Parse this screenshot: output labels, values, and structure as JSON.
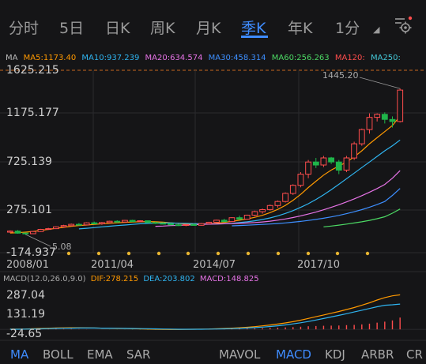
{
  "tabs": [
    {
      "label": "分时"
    },
    {
      "label": "5日"
    },
    {
      "label": "日K"
    },
    {
      "label": "周K"
    },
    {
      "label": "月K"
    },
    {
      "label": "季K",
      "active": true
    },
    {
      "label": "年K"
    },
    {
      "label": "1分"
    }
  ],
  "accent": "#3f8cff",
  "ma_legend": {
    "ma": "MA",
    "ma5": "MA5:1173.40",
    "ma10": "MA10:937.239",
    "ma20": "MA20:634.574",
    "ma30": "MA30:458.314",
    "ma60": "MA60:256.263",
    "ma120": "MA120:",
    "ma250": "MA250:"
  },
  "ma_colors": {
    "ma5": "#ff9900",
    "ma10": "#2fb4f0",
    "ma20": "#e673e6",
    "ma30": "#3d8fff",
    "ma60": "#4cd964",
    "ma120": "#ff4d4d",
    "ma250": "#44c8d8"
  },
  "price_axis": [
    "1625.215",
    "1175.177",
    "725.139",
    "275.101",
    "-174.937"
  ],
  "annotations": {
    "high": "1445.20",
    "low": "5.08"
  },
  "time_axis": [
    "2008/01",
    "2011/04",
    "2014/07",
    "2017/10"
  ],
  "macd_legend": {
    "params": "MACD(12.0,26.0,9.0)",
    "dif": "DIF:278.215",
    "dea": "DEA:203.802",
    "macd": "MACD:148.825"
  },
  "macd_axis": [
    "287.04",
    "131.19",
    "-24.65"
  ],
  "indicator_tabs_left": [
    "MA",
    "BOLL",
    "EMA",
    "SAR"
  ],
  "indicator_tabs_right": [
    "MAVOL",
    "MACD",
    "KDJ",
    "ARBR",
    "CR"
  ],
  "chart_data": {
    "type": "candlestick",
    "period": "quarterly",
    "price_range": [
      -174.937,
      1625.215
    ],
    "first_label": "2008/01",
    "candles": [
      {
        "o": 28,
        "h": 45,
        "l": 22,
        "c": 38
      },
      {
        "o": 38,
        "h": 48,
        "l": 12,
        "c": 18
      },
      {
        "o": 18,
        "h": 25,
        "l": 5.08,
        "c": 12
      },
      {
        "o": 12,
        "h": 40,
        "l": 10,
        "c": 34
      },
      {
        "o": 34,
        "h": 60,
        "l": 30,
        "c": 55
      },
      {
        "o": 55,
        "h": 70,
        "l": 50,
        "c": 62
      },
      {
        "o": 62,
        "h": 85,
        "l": 58,
        "c": 80
      },
      {
        "o": 80,
        "h": 100,
        "l": 70,
        "c": 92
      },
      {
        "o": 92,
        "h": 112,
        "l": 85,
        "c": 105
      },
      {
        "o": 105,
        "h": 118,
        "l": 95,
        "c": 100
      },
      {
        "o": 100,
        "h": 125,
        "l": 95,
        "c": 120
      },
      {
        "o": 120,
        "h": 132,
        "l": 105,
        "c": 110
      },
      {
        "o": 110,
        "h": 128,
        "l": 100,
        "c": 122
      },
      {
        "o": 122,
        "h": 140,
        "l": 115,
        "c": 135
      },
      {
        "o": 135,
        "h": 145,
        "l": 120,
        "c": 128
      },
      {
        "o": 128,
        "h": 148,
        "l": 122,
        "c": 144
      },
      {
        "o": 144,
        "h": 150,
        "l": 130,
        "c": 132
      },
      {
        "o": 132,
        "h": 145,
        "l": 125,
        "c": 140
      },
      {
        "o": 140,
        "h": 142,
        "l": 118,
        "c": 122
      },
      {
        "o": 122,
        "h": 130,
        "l": 108,
        "c": 115
      },
      {
        "o": 115,
        "h": 125,
        "l": 105,
        "c": 110
      },
      {
        "o": 110,
        "h": 118,
        "l": 95,
        "c": 100
      },
      {
        "o": 100,
        "h": 110,
        "l": 88,
        "c": 95
      },
      {
        "o": 95,
        "h": 108,
        "l": 86,
        "c": 102
      },
      {
        "o": 102,
        "h": 112,
        "l": 92,
        "c": 96
      },
      {
        "o": 96,
        "h": 118,
        "l": 92,
        "c": 112
      },
      {
        "o": 112,
        "h": 130,
        "l": 105,
        "c": 125
      },
      {
        "o": 125,
        "h": 150,
        "l": 118,
        "c": 145
      },
      {
        "o": 145,
        "h": 160,
        "l": 125,
        "c": 132
      },
      {
        "o": 132,
        "h": 175,
        "l": 128,
        "c": 170
      },
      {
        "o": 170,
        "h": 190,
        "l": 150,
        "c": 155
      },
      {
        "o": 155,
        "h": 200,
        "l": 150,
        "c": 195
      },
      {
        "o": 195,
        "h": 240,
        "l": 185,
        "c": 230
      },
      {
        "o": 230,
        "h": 260,
        "l": 210,
        "c": 250
      },
      {
        "o": 250,
        "h": 300,
        "l": 240,
        "c": 290
      },
      {
        "o": 290,
        "h": 340,
        "l": 270,
        "c": 330
      },
      {
        "o": 330,
        "h": 420,
        "l": 320,
        "c": 410
      },
      {
        "o": 410,
        "h": 500,
        "l": 395,
        "c": 490
      },
      {
        "o": 490,
        "h": 620,
        "l": 470,
        "c": 600
      },
      {
        "o": 600,
        "h": 740,
        "l": 560,
        "c": 720
      },
      {
        "o": 720,
        "h": 760,
        "l": 660,
        "c": 690
      },
      {
        "o": 690,
        "h": 780,
        "l": 670,
        "c": 760
      },
      {
        "o": 760,
        "h": 770,
        "l": 700,
        "c": 720
      },
      {
        "o": 720,
        "h": 740,
        "l": 600,
        "c": 640
      },
      {
        "o": 640,
        "h": 780,
        "l": 620,
        "c": 760
      },
      {
        "o": 760,
        "h": 920,
        "l": 740,
        "c": 900
      },
      {
        "o": 900,
        "h": 1050,
        "l": 880,
        "c": 1040
      },
      {
        "o": 1040,
        "h": 1200,
        "l": 1000,
        "c": 1160
      },
      {
        "o": 1160,
        "h": 1200,
        "l": 1120,
        "c": 1190
      },
      {
        "o": 1190,
        "h": 1210,
        "l": 1100,
        "c": 1140
      },
      {
        "o": 1140,
        "h": 1170,
        "l": 1060,
        "c": 1120
      },
      {
        "o": 1120,
        "h": 1445.2,
        "l": 1110,
        "c": 1430
      }
    ],
    "ma_series": {
      "ma5": [
        18,
        22,
        28,
        35,
        45,
        55,
        65,
        75,
        85,
        92,
        98,
        104,
        110,
        115,
        120,
        124,
        128,
        130,
        132,
        130,
        126,
        120,
        114,
        108,
        105,
        104,
        108,
        115,
        124,
        134,
        145,
        158,
        174,
        194,
        220,
        252,
        292,
        342,
        400,
        468,
        530,
        590,
        640,
        680,
        720,
        770,
        830,
        900,
        960,
        1020,
        1080,
        1173.4
      ],
      "ma10": [
        null,
        null,
        null,
        null,
        null,
        null,
        null,
        null,
        null,
        60,
        66,
        72,
        80,
        86,
        92,
        98,
        104,
        110,
        114,
        116,
        118,
        118,
        116,
        114,
        112,
        110,
        108,
        108,
        110,
        115,
        122,
        130,
        140,
        152,
        168,
        188,
        212,
        240,
        272,
        308,
        350,
        396,
        446,
        500,
        555,
        610,
        665,
        720,
        775,
        830,
        880,
        937.239
      ],
      "ma20": [
        null,
        null,
        null,
        null,
        null,
        null,
        null,
        null,
        null,
        null,
        null,
        null,
        null,
        null,
        null,
        null,
        null,
        null,
        null,
        85,
        88,
        92,
        95,
        98,
        101,
        104,
        106,
        108,
        110,
        112,
        114,
        118,
        122,
        128,
        136,
        146,
        158,
        172,
        188,
        206,
        226,
        248,
        272,
        298,
        326,
        356,
        388,
        422,
        458,
        498,
        560,
        634.574
      ],
      "ma30": [
        null,
        null,
        null,
        null,
        null,
        null,
        null,
        null,
        null,
        null,
        null,
        null,
        null,
        null,
        null,
        null,
        null,
        null,
        null,
        null,
        null,
        null,
        null,
        null,
        null,
        null,
        null,
        null,
        null,
        90,
        93,
        96,
        100,
        104,
        108,
        113,
        119,
        126,
        134,
        143,
        153,
        165,
        178,
        193,
        210,
        229,
        250,
        274,
        300,
        330,
        390,
        458.314
      ],
      "ma60": [
        null,
        null,
        null,
        null,
        null,
        null,
        null,
        null,
        null,
        null,
        null,
        null,
        null,
        null,
        null,
        null,
        null,
        null,
        null,
        null,
        null,
        null,
        null,
        null,
        null,
        null,
        null,
        null,
        null,
        null,
        null,
        null,
        null,
        null,
        null,
        null,
        null,
        null,
        null,
        null,
        null,
        80,
        88,
        97,
        107,
        118,
        130,
        144,
        160,
        180,
        215,
        256.263
      ]
    },
    "macd": {
      "range": [
        -24.65,
        287.04
      ],
      "dif": [
        2,
        2,
        3,
        5,
        7,
        9,
        11,
        12,
        13,
        13,
        12,
        11,
        10,
        9,
        8,
        7,
        5,
        4,
        2,
        1,
        0,
        -1,
        -1,
        0,
        1,
        2,
        3,
        5,
        7,
        10,
        13,
        17,
        22,
        28,
        35,
        43,
        52,
        62,
        74,
        88,
        102,
        116,
        130,
        144,
        160,
        176,
        194,
        214,
        236,
        256,
        270,
        278.215
      ],
      "dea": [
        1,
        1,
        2,
        3,
        4,
        6,
        8,
        9,
        10,
        11,
        11,
        11,
        10,
        10,
        9,
        8,
        7,
        6,
        5,
        4,
        3,
        2,
        1,
        1,
        1,
        1,
        2,
        3,
        4,
        6,
        8,
        11,
        14,
        18,
        23,
        29,
        36,
        44,
        53,
        63,
        75,
        87,
        100,
        113,
        126,
        140,
        154,
        168,
        182,
        194,
        198,
        203.802
      ],
      "hist": [
        0,
        0,
        1,
        2,
        3,
        3,
        3,
        3,
        3,
        2,
        1,
        0,
        0,
        -1,
        -1,
        -1,
        -2,
        -2,
        -3,
        -3,
        -3,
        -3,
        -2,
        -1,
        0,
        1,
        1,
        2,
        3,
        4,
        5,
        6,
        8,
        10,
        12,
        14,
        16,
        18,
        21,
        25,
        27,
        29,
        30,
        31,
        34,
        36,
        40,
        46,
        54,
        62,
        72,
        148.825
      ]
    }
  }
}
